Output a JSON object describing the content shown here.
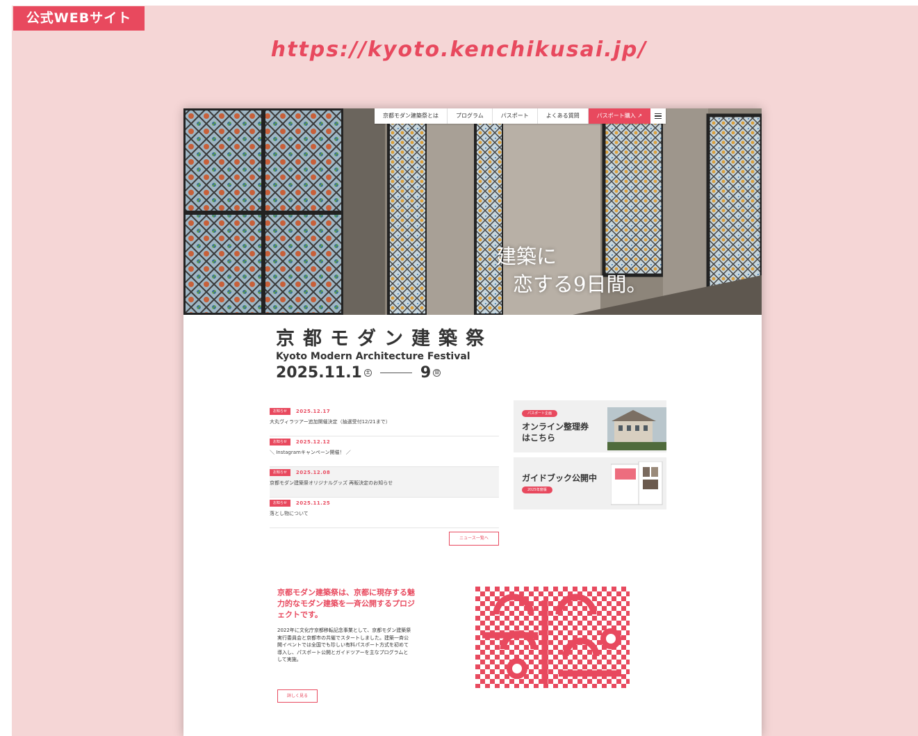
{
  "label": "公式WEBサイト",
  "url": "https://kyoto.kenchikusai.jp/",
  "colors": {
    "accent": "#e8495e",
    "background": "#f5d6d6"
  },
  "nav": {
    "items": [
      "京都モダン建築祭とは",
      "プログラム",
      "パスポート",
      "よくある質問"
    ],
    "buy": "パスポート購入",
    "menu_icon": "hamburger-icon",
    "external_icon": "external-link-icon"
  },
  "hero": {
    "catch_line1": "建築に",
    "catch_line2": "恋する9日間。"
  },
  "festival": {
    "title": "京都モダン建築祭",
    "subtitle": "Kyoto Modern Architecture Festival",
    "date_start": "2025.11.1",
    "date_end": "9"
  },
  "news": {
    "items": [
      {
        "badge": "お知らせ",
        "date": "2025.12.17",
        "title": "大丸ヴィラツアー追加開催決定（抽選受付12/21まで）"
      },
      {
        "badge": "お知らせ",
        "date": "2025.12.12",
        "title": "＼ Instagramキャンペーン開催！ ／"
      },
      {
        "badge": "お知らせ",
        "date": "2025.12.08",
        "title": "京都モダン建築祭オリジナルグッズ 再販決定のお知らせ"
      },
      {
        "badge": "お知らせ",
        "date": "2025.11.25",
        "title": "落とし物について"
      }
    ],
    "more": "ニュース一覧へ"
  },
  "cards": [
    {
      "pill": "パスポート企画",
      "title_line1": "オンライン整理券",
      "title_line2": "はこちら"
    },
    {
      "pill": "2025年度版",
      "title_line1": "ガイドブック公開中"
    }
  ],
  "about": {
    "lead": "京都モダン建築祭は、京都に現存する魅力的なモダン建築を一斉公開するプロジェクトです。",
    "body": "2022年に文化庁京都移転記念事業として、京都モダン建築祭実行委員会と京都市の共催でスタートしました。建築一斉公開イベントでは全国でも珍しい有料パスポート方式を初めて導入し、パスポート公開とガイドツアーを主なプログラムとして実施。",
    "button": "詳しく見る"
  }
}
